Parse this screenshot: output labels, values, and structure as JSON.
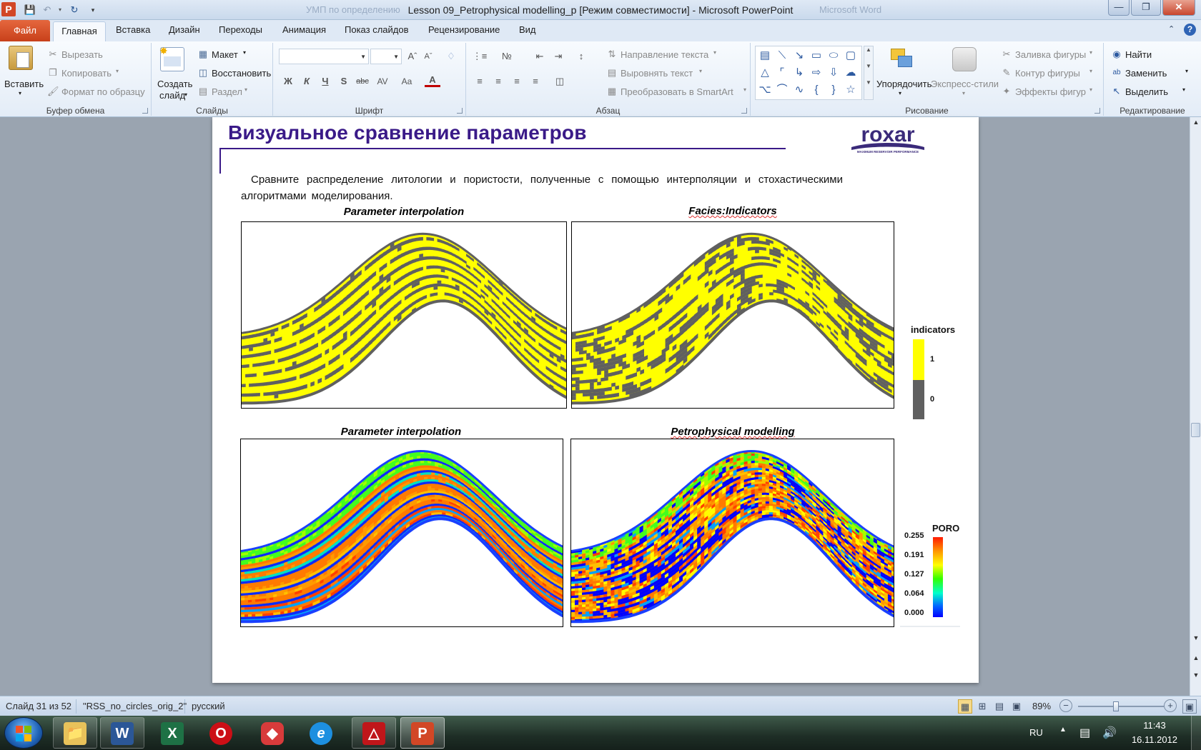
{
  "window": {
    "title": "Lesson 09_Petrophysical modelling_p [Режим совместимости] - Microsoft PowerPoint",
    "bg_left": "УМП по определению",
    "bg_right": "Microsoft Word"
  },
  "ribbon_tabs": [
    "Файл",
    "Главная",
    "Вставка",
    "Дизайн",
    "Переходы",
    "Анимация",
    "Показ слайдов",
    "Рецензирование",
    "Вид"
  ],
  "clipboard": {
    "paste": "Вставить",
    "cut": "Вырезать",
    "copy": "Копировать",
    "format_painter": "Формат по образцу",
    "label": "Буфер обмена"
  },
  "slides": {
    "new_slide_1": "Создать",
    "new_slide_2": "слайд",
    "layout": "Макет",
    "reset": "Восстановить",
    "section": "Раздел",
    "label": "Слайды"
  },
  "font": {
    "label": "Шрифт",
    "bold": "Ж",
    "italic": "К",
    "underline": "Ч",
    "shadow": "S",
    "strike": "abc",
    "spacing": "AV",
    "case": "Aa",
    "color": "A"
  },
  "paragraph": {
    "label": "Абзац",
    "text_direction": "Направление текста",
    "align_text": "Выровнять текст",
    "smartart": "Преобразовать в SmartArt"
  },
  "drawing": {
    "arrange": "Упорядочить",
    "quick_styles": "Экспресс-стили",
    "shape_fill": "Заливка фигуры",
    "shape_outline": "Контур фигуры",
    "shape_effects": "Эффекты фигур",
    "label": "Рисование"
  },
  "editing": {
    "find": "Найти",
    "replace": "Заменить",
    "select": "Выделить",
    "label": "Редактирование"
  },
  "slide": {
    "title": "Визуальное сравнение параметров",
    "logo_text": "roxar",
    "logo_tagline": "MAXIMUM RESERVOIR PERFORMANCE",
    "body": "Сравните распределение литологии и пористости, полученные с помощью интерполяции и стохастическими алгоритмами моделирования.",
    "plots": [
      {
        "title": "Parameter interpolation"
      },
      {
        "title": "Facies:Indicators"
      },
      {
        "title": "Parameter interpolation"
      },
      {
        "title": "Petrophysical modelling"
      }
    ],
    "indicator_legend": {
      "title": "indicators",
      "labels": [
        "1",
        "0"
      ],
      "colors": [
        "#ffff00",
        "#606060"
      ]
    },
    "poro_legend": {
      "title": "PORO",
      "labels": [
        "0.255",
        "0.191",
        "0.127",
        "0.064",
        "0.000"
      ]
    }
  },
  "status": {
    "slide_info": "Слайд 31 из 52",
    "theme": "\"RSS_no_circles_orig_2\"",
    "language": "русский",
    "zoom": "89%",
    "zoom_fraction": 0.89
  },
  "taskbar": {
    "apps": [
      "explorer-icon",
      "word-icon",
      "excel-icon",
      "opera-icon",
      "app-icon",
      "ie-icon",
      "acrobat-icon",
      "powerpoint-icon"
    ],
    "lang": "RU",
    "time": "11:43",
    "date": "16.11.2012"
  }
}
